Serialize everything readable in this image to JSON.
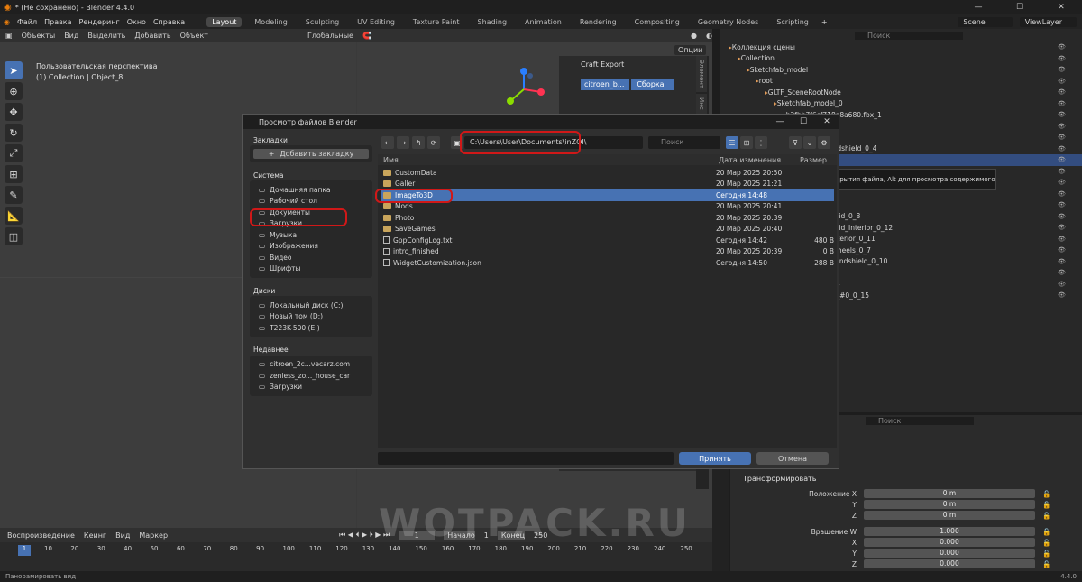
{
  "window": {
    "title": "* (Не сохранено) - Blender 4.4.0",
    "minimize": "—",
    "maximize": "☐",
    "close": "✕"
  },
  "menubar": {
    "items": [
      "Файл",
      "Правка",
      "Рендеринг",
      "Окно",
      "Справка"
    ],
    "workspaces": [
      "Layout",
      "Modeling",
      "Sculpting",
      "UV Editing",
      "Texture Paint",
      "Shading",
      "Animation",
      "Rendering",
      "Compositing",
      "Geometry Nodes",
      "Scripting"
    ],
    "active_workspace": "Layout",
    "add_tab": "+",
    "scene": "Scene",
    "viewlayer": "ViewLayer"
  },
  "toolbar": {
    "mode": "Объекты",
    "items": [
      "Вид",
      "Выделить",
      "Добавить",
      "Объект"
    ],
    "transform": "Глобальные",
    "options": "Опции"
  },
  "viewport": {
    "perspective": "Пользовательская перспектива",
    "collection": "(1) Collection | Object_8"
  },
  "n_panel": {
    "title": "Craft Export",
    "tabs": [
      "Элемент",
      "Инс"
    ],
    "field": "citroen_b...",
    "button": "Сборка"
  },
  "outliner": {
    "search_placeholder": "Поиск",
    "rows": [
      {
        "t": "Коллекция сцены",
        "d": 0
      },
      {
        "t": "Collection",
        "d": 1
      },
      {
        "t": "Sketchfab_model",
        "d": 2
      },
      {
        "t": "root",
        "d": 3
      },
      {
        "t": "GLTF_SceneRootNode",
        "d": 4
      },
      {
        "t": "Sketchfab_model_0",
        "d": 5
      },
      {
        "t": "b2fbb7f6cf718a8a680.fbx_1",
        "d": 6
      },
      {
        "t": "",
        "d": 6
      },
      {
        "t": "dshield_3",
        "d": 6
      },
      {
        "t": "Vindshield_Windshield_0_4",
        "d": 6
      },
      {
        "t": "Object_8",
        "d": 6,
        "sel": true
      },
      {
        "t": "",
        "d": 6
      },
      {
        "t": "",
        "d": 6
      },
      {
        "t": "",
        "d": 6
      },
      {
        "t": "",
        "d": 6
      },
      {
        "t": "JV_Plane040_Grid_0_8",
        "d": 6
      },
      {
        "t": "JV_Plane040_Grid_Interior_0_12",
        "d": 6
      },
      {
        "t": "JV_Plane040_Interior_0_11",
        "d": 6
      },
      {
        "t": "JV_Plane040_Wheels_0_7",
        "d": 6
      },
      {
        "t": "JV_Plane040_Windshield_0_10",
        "d": 6
      },
      {
        "t": "l_13",
        "d": 6
      },
      {
        "t": "ct001_Car_0_14",
        "d": 6
      },
      {
        "t": "ct001_Material_#0_0_15",
        "d": 6
      }
    ]
  },
  "tooltip": "крытия файла, Alt для просмотра содержимого",
  "props": {
    "search_placeholder": "Поиск",
    "section": "Трансформировать",
    "rows": [
      {
        "label": "Положение X",
        "value": "0 m"
      },
      {
        "label": "Y",
        "value": "0 m"
      },
      {
        "label": "Z",
        "value": "0 m"
      },
      {
        "label": "Вращение W",
        "value": "1.000"
      },
      {
        "label": "X",
        "value": "0.000"
      },
      {
        "label": "Y",
        "value": "0.000"
      },
      {
        "label": "Z",
        "value": "0.000"
      }
    ]
  },
  "timeline": {
    "items": [
      "Воспроизведение",
      "Кеинг",
      "Вид",
      "Маркер"
    ],
    "frame": "1",
    "start_label": "Начало",
    "start": "1",
    "end_label": "Конец",
    "end": "250",
    "ticks": [
      "1",
      "10",
      "20",
      "30",
      "40",
      "50",
      "60",
      "70",
      "80",
      "90",
      "100",
      "110",
      "120",
      "130",
      "140",
      "150",
      "160",
      "170",
      "180",
      "190",
      "200",
      "210",
      "220",
      "230",
      "240",
      "250"
    ]
  },
  "status": {
    "hint": "Панорамировать вид",
    "version": "4.4.0"
  },
  "watermark": "WOTPACK.RU",
  "dialog": {
    "title": "Просмотр файлов Blender",
    "bookmarks_header": "Закладки",
    "add_bookmark": "Добавить закладку",
    "system_header": "Система",
    "system": [
      "Домашняя папка",
      "Рабочий стол",
      "Документы",
      "Загрузки",
      "Музыка",
      "Изображения",
      "Видео",
      "Шрифты"
    ],
    "disks_header": "Диски",
    "disks": [
      "Локальный диск (C:)",
      "Новый том (D:)",
      "T223K-500 (E:)"
    ],
    "recent_header": "Недавнее",
    "recent": [
      "citroen_2c...vecarz.com",
      "zenless_zo..._house_car",
      "Загрузки"
    ],
    "path": "C:\\Users\\User\\Documents\\inZOI\\",
    "search_placeholder": "Поиск",
    "columns": {
      "name": "Имя",
      "date": "Дата изменения",
      "size": "Размер"
    },
    "files": [
      {
        "name": "CustomData",
        "date": "20 Мар 2025 20:50",
        "size": "",
        "type": "folder"
      },
      {
        "name": "Galler",
        "date": "20 Мар 2025 21:21",
        "size": "",
        "type": "folder"
      },
      {
        "name": "ImageTo3D",
        "date": "Сегодня 14:48",
        "size": "",
        "type": "folder",
        "sel": true
      },
      {
        "name": "Mods",
        "date": "20 Мар 2025 20:41",
        "size": "",
        "type": "folder"
      },
      {
        "name": "Photo",
        "date": "20 Мар 2025 20:39",
        "size": "",
        "type": "folder"
      },
      {
        "name": "SaveGames",
        "date": "20 Мар 2025 20:40",
        "size": "",
        "type": "folder"
      },
      {
        "name": "GppConfigLog.txt",
        "date": "Сегодня 14:42",
        "size": "480 B",
        "type": "file"
      },
      {
        "name": "intro_finished",
        "date": "20 Мар 2025 20:39",
        "size": "0 B",
        "type": "file"
      },
      {
        "name": "WidgetCustomization.json",
        "date": "Сегодня 14:50",
        "size": "288 B",
        "type": "file"
      }
    ],
    "accept": "Принять",
    "cancel": "Отмена"
  },
  "colors": {
    "accent": "#4772b3",
    "highlight": "#d01818",
    "folder": "#c9a55b"
  }
}
